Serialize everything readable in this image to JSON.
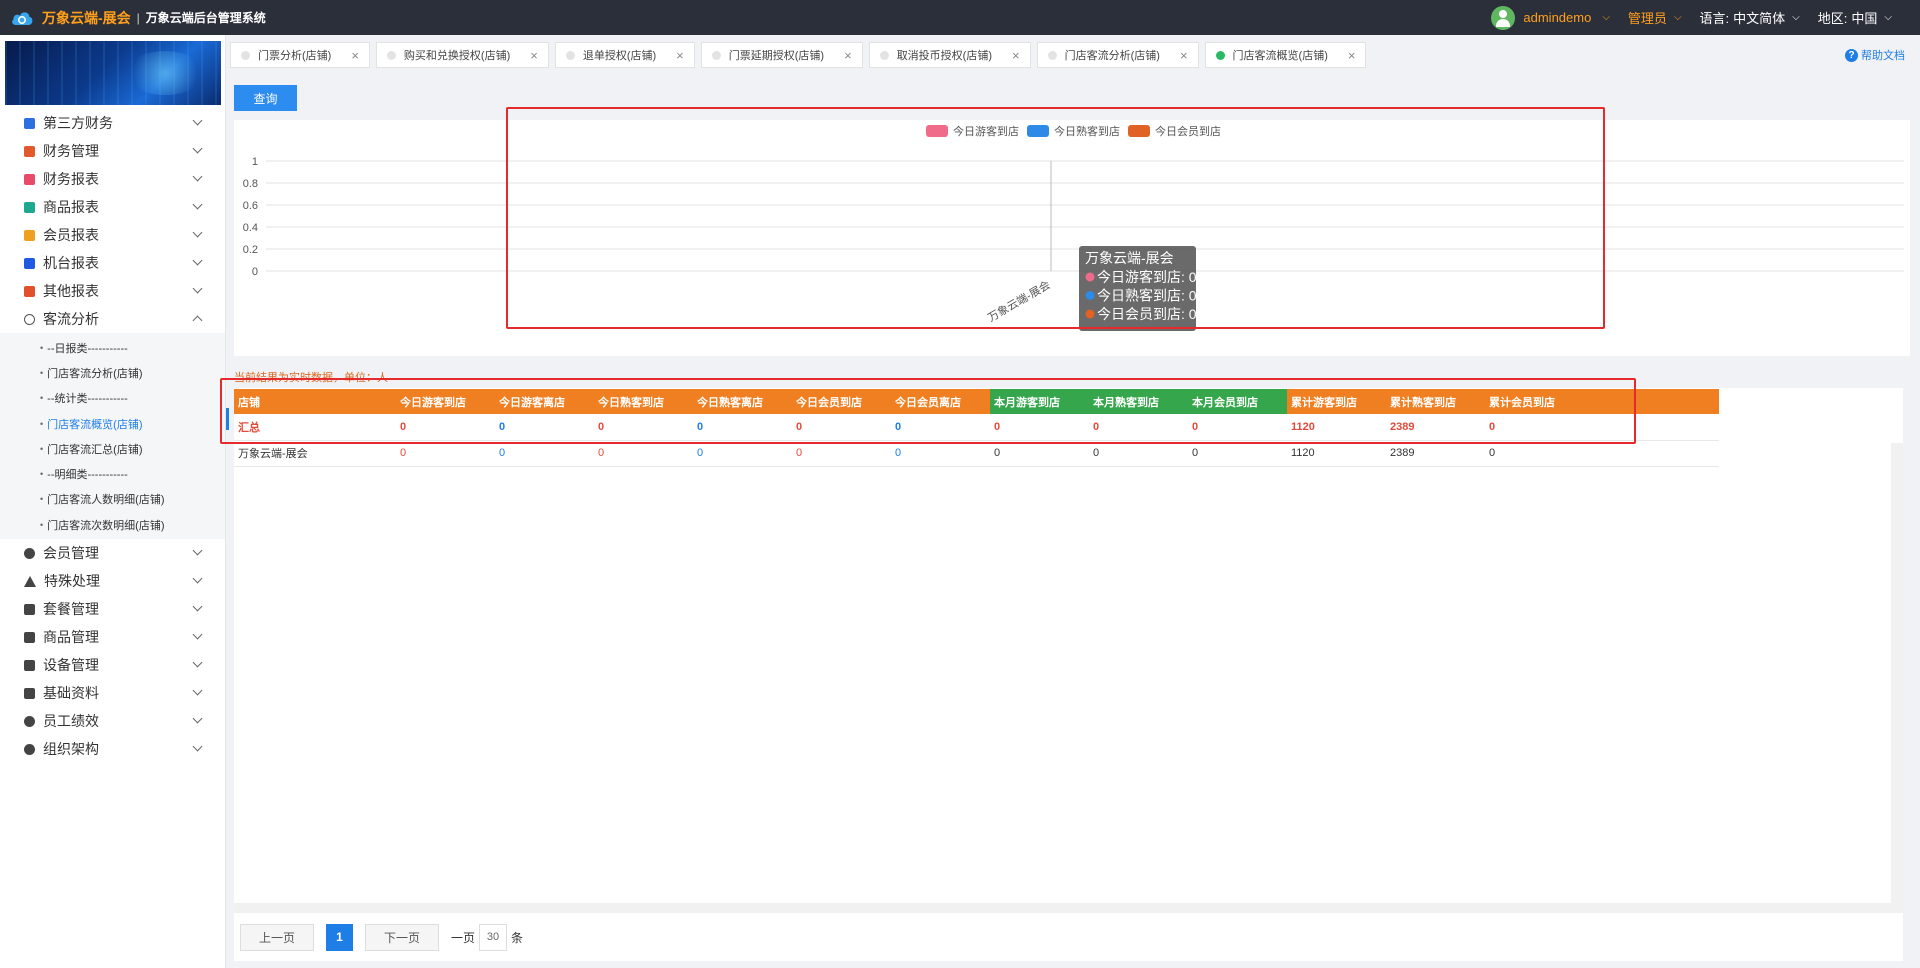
{
  "header": {
    "brand": "万象云端-展会",
    "divider": "|",
    "subtitle": "万象云端后台管理系统",
    "user": "admindemo",
    "role": "管理员",
    "language_label": "语言:",
    "language_value": "中文简体",
    "region_label": "地区:",
    "region_value": "中国"
  },
  "sidebar": {
    "items": [
      {
        "label": "第三方财务",
        "icon_color": "#2d6fe0"
      },
      {
        "label": "财务管理",
        "icon_color": "#e05a2d"
      },
      {
        "label": "财务报表",
        "icon_color": "#e84a6a"
      },
      {
        "label": "商品报表",
        "icon_color": "#1fa890"
      },
      {
        "label": "会员报表",
        "icon_color": "#f0a020"
      },
      {
        "label": "机台报表",
        "icon_color": "#1f5ae0"
      },
      {
        "label": "其他报表",
        "icon_color": "#e0502d"
      },
      {
        "label": "客流分析",
        "icon_color": "#555555"
      }
    ],
    "submenu": [
      {
        "label": "--日报类-----------"
      },
      {
        "label": "门店客流分析(店铺)"
      },
      {
        "label": "--统计类-----------"
      },
      {
        "label": "门店客流概览(店铺)"
      },
      {
        "label": "门店客流汇总(店铺)"
      },
      {
        "label": "--明细类-----------"
      },
      {
        "label": "门店客流人数明细(店铺)"
      },
      {
        "label": "门店客流次数明细(店铺)"
      }
    ],
    "items_after": [
      {
        "label": "会员管理"
      },
      {
        "label": "特殊处理"
      },
      {
        "label": "套餐管理"
      },
      {
        "label": "商品管理"
      },
      {
        "label": "设备管理"
      },
      {
        "label": "基础资料"
      },
      {
        "label": "员工绩效"
      },
      {
        "label": "组织架构"
      }
    ]
  },
  "tabs": [
    {
      "label": "门票分析(店铺)",
      "active": false
    },
    {
      "label": "购买和兑换授权(店铺)",
      "active": false
    },
    {
      "label": "退单授权(店铺)",
      "active": false
    },
    {
      "label": "门票延期授权(店铺)",
      "active": false
    },
    {
      "label": "取消投币授权(店铺)",
      "active": false
    },
    {
      "label": "门店客流分析(店铺)",
      "active": false
    },
    {
      "label": "门店客流概览(店铺)",
      "active": true
    }
  ],
  "help_label": "帮助文档",
  "query_label": "查询",
  "chart_data": {
    "type": "bar",
    "categories": [
      "万象云端-展会"
    ],
    "series": [
      {
        "name": "今日游客到店",
        "values": [
          0
        ],
        "color": "#f06a8a"
      },
      {
        "name": "今日熟客到店",
        "values": [
          0
        ],
        "color": "#2d8ae6"
      },
      {
        "name": "今日会员到店",
        "values": [
          0
        ],
        "color": "#e06224"
      }
    ],
    "ylim": [
      0,
      1
    ],
    "yticks": [
      "1",
      "0.8",
      "0.6",
      "0.4",
      "0.2",
      "0"
    ],
    "legend_position": "top-center",
    "tooltip": {
      "title": "万象云端-展会",
      "lines": [
        "今日游客到店: 0",
        "今日熟客到店: 0",
        "今日会员到店: 0"
      ]
    }
  },
  "caption": "当前结果为实时数据，单位：人",
  "table": {
    "columns": [
      {
        "label": "店铺",
        "group": "o"
      },
      {
        "label": "今日游客到店",
        "group": "o"
      },
      {
        "label": "今日游客离店",
        "group": "o"
      },
      {
        "label": "今日熟客到店",
        "group": "o"
      },
      {
        "label": "今日熟客离店",
        "group": "o"
      },
      {
        "label": "今日会员到店",
        "group": "o"
      },
      {
        "label": "今日会员离店",
        "group": "o"
      },
      {
        "label": "本月游客到店",
        "group": "g"
      },
      {
        "label": "本月熟客到店",
        "group": "g"
      },
      {
        "label": "本月会员到店",
        "group": "g"
      },
      {
        "label": "累计游客到店",
        "group": "o"
      },
      {
        "label": "累计熟客到店",
        "group": "o"
      },
      {
        "label": "累计会员到店",
        "group": "o"
      }
    ],
    "total_row": [
      "汇总",
      "0",
      "0",
      "0",
      "0",
      "0",
      "0",
      "0",
      "0",
      "0",
      "1120",
      "2389",
      "0"
    ],
    "rows": [
      [
        "万象云端-展会",
        "0",
        "0",
        "0",
        "0",
        "0",
        "0",
        "0",
        "0",
        "0",
        "1120",
        "2389",
        "0"
      ]
    ]
  },
  "pager": {
    "prev": "上一页",
    "current": "1",
    "next": "下一页",
    "size_prefix": "一页",
    "size_value": "30",
    "size_suffix": "条"
  }
}
